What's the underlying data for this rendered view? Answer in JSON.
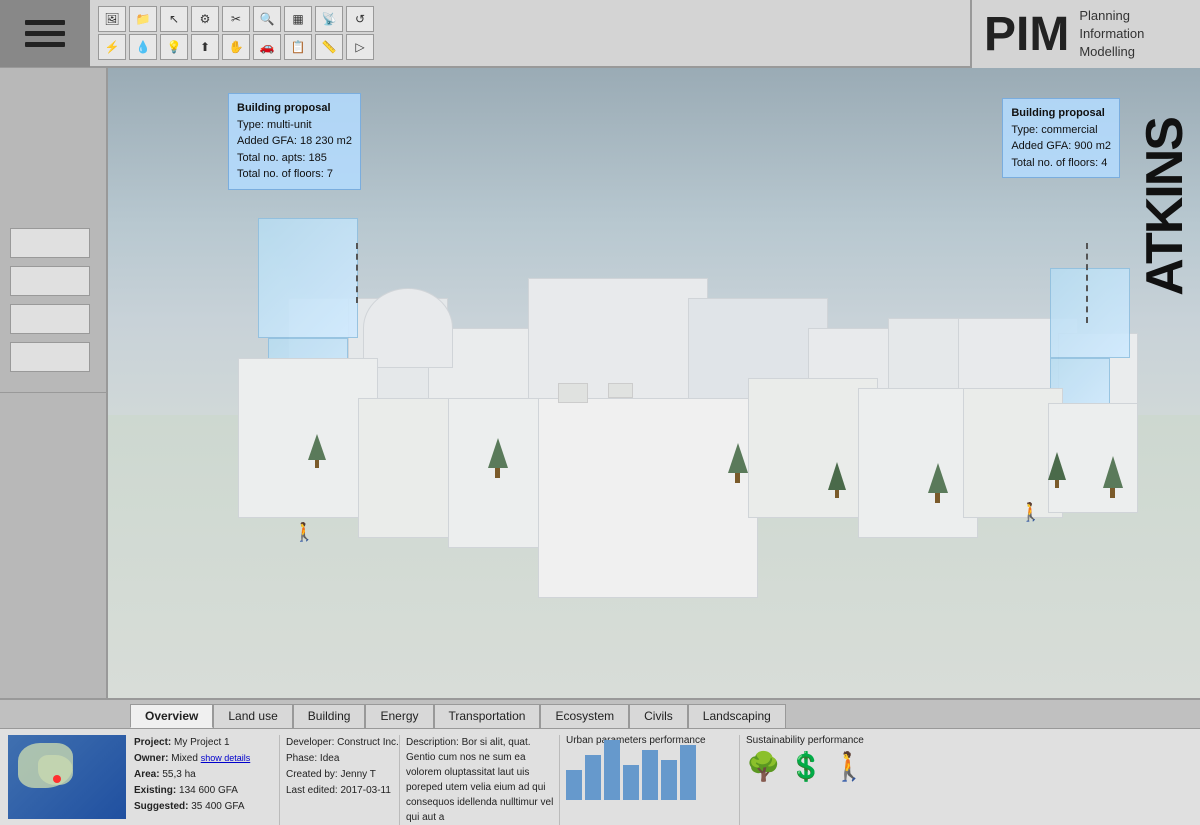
{
  "app": {
    "title": "Planning PIM Information Modelling"
  },
  "header": {
    "pim_label": "PIM",
    "pim_subtitle_line1": "Planning",
    "pim_subtitle_line2": "Information",
    "pim_subtitle_line3": "Modelling",
    "atkins_label": "ATKINS"
  },
  "toolbar": {
    "buttons_row1": [
      "📷",
      "📁",
      "↖",
      "⚙",
      "✂",
      "🔍",
      "▦",
      "📡",
      "↺"
    ],
    "buttons_row2": [
      "⚡",
      "💧",
      "💡",
      "⬆",
      "✋",
      "🚗",
      "📋",
      "📏",
      "▷"
    ]
  },
  "sidebar": {
    "buttons": [
      "",
      "",
      "",
      ""
    ]
  },
  "viewport": {
    "tooltip_left": {
      "title": "Building proposal",
      "type": "Type: multi-unit",
      "gfa": "Added GFA: 18 230 m2",
      "apts": "Total no. apts: 185",
      "floors": "Total no. of floors: 7"
    },
    "tooltip_right": {
      "title": "Building proposal",
      "type": "Type: commercial",
      "gfa": "Added GFA: 900 m2",
      "floors": "Total no. of floors: 4"
    }
  },
  "tabs": {
    "items": [
      "Overview",
      "Land use",
      "Building",
      "Energy",
      "Transportation",
      "Ecosystem",
      "Civils",
      "Landscaping"
    ],
    "active": "Overview"
  },
  "info_panel": {
    "project_label": "Project:",
    "project_value": "My Project 1",
    "owner_label": "Owner:",
    "owner_value": "Mixed",
    "show_details": "show details",
    "area_label": "Area:",
    "area_value": "55,3 ha",
    "existing_label": "Existing:",
    "existing_value": "134 600 GFA",
    "suggested_label": "Suggested:",
    "suggested_value": "35 400 GFA",
    "developer_label": "Developer:",
    "developer_value": "Construct Inc.",
    "phase_label": "Phase:",
    "phase_value": "Idea",
    "created_by_label": "Created by:",
    "created_by_value": "Jenny T",
    "last_edited_label": "Last edited:",
    "last_edited_value": "2017-03-11",
    "description_label": "Description:",
    "description_value": "Bor si alit, quat. Gentio cum nos ne sum ea volorem oluptassitat laut uis poreped utem velia eium ad qui consequos idellenda nulltimur vel qui aut a",
    "urban_chart_title": "Urban parameters performance",
    "sustainability_title": "Sustainability performance",
    "chart_bars": [
      30,
      45,
      60,
      35,
      50,
      40,
      55
    ]
  }
}
